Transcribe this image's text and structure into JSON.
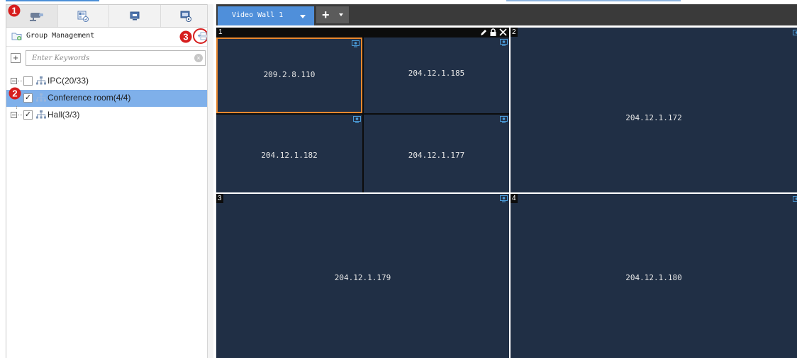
{
  "left_panel": {
    "tabs": [
      {
        "name": "devices-tab",
        "icon": "camera-icon"
      },
      {
        "name": "layout-tab",
        "icon": "window-layout-icon"
      },
      {
        "name": "display-tab",
        "icon": "screen-icon"
      },
      {
        "name": "wall-config-tab",
        "icon": "wall-settings-icon"
      }
    ],
    "group_management_label": "Group Management",
    "search_placeholder": "Enter Keywords",
    "tree": [
      {
        "label": "IPC(20/33)",
        "checked": false,
        "selected": false
      },
      {
        "label": "Conference room(4/4)",
        "checked": true,
        "selected": true
      },
      {
        "label": "Hall(3/3)",
        "checked": true,
        "selected": false
      }
    ],
    "markers": {
      "one": "1",
      "two": "2",
      "three": "3"
    }
  },
  "toolbar": {
    "wall_tab_label": "Video Wall 1",
    "add_label": "+"
  },
  "screens": [
    {
      "number": "1",
      "windows": [
        "209.2.8.110",
        "204.12.1.185",
        "204.12.1.182",
        "204.12.1.177"
      ]
    },
    {
      "number": "2",
      "windows": [
        "204.12.1.172"
      ]
    },
    {
      "number": "3",
      "windows": [
        "204.12.1.179"
      ]
    },
    {
      "number": "4",
      "windows": [
        "204.12.1.180"
      ]
    }
  ],
  "colors": {
    "accent": "#4f8fda",
    "screen_bg": "#213047",
    "selected_window_border": "#e8882f",
    "selected_row": "#7fb0ea",
    "marker_red": "#d61e1e"
  }
}
